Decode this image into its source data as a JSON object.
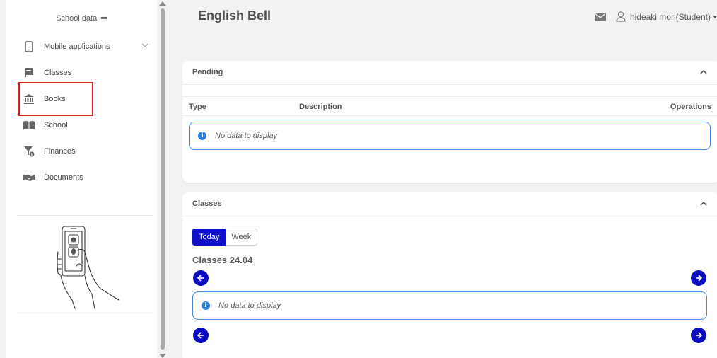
{
  "sidebar": {
    "school_data_label": "School data",
    "school_data_more": "•••",
    "items": [
      {
        "label": "Mobile applications",
        "icon": "mobile-icon",
        "expandable": true
      },
      {
        "label": "Classes",
        "icon": "classes-book-icon"
      },
      {
        "label": "Books",
        "icon": "library-icon",
        "highlighted": true
      },
      {
        "label": "School",
        "icon": "open-book-icon"
      },
      {
        "label": "Finances",
        "icon": "finance-filter-icon"
      },
      {
        "label": "Documents",
        "icon": "handshake-icon"
      }
    ],
    "highlight_color": "#e01818"
  },
  "header": {
    "title": "English Bell",
    "user_name": "hideaki mori(Student)"
  },
  "pending": {
    "title": "Pending",
    "columns": [
      "Type",
      "Description",
      "Operations"
    ],
    "empty_message": "No data to display"
  },
  "classes": {
    "title": "Classes",
    "tabs": [
      {
        "label": "Today",
        "active": true
      },
      {
        "label": "Week",
        "active": false
      }
    ],
    "date_heading": "Classes 24.04",
    "empty_message": "No data to display"
  },
  "colors": {
    "accent": "#1010c8",
    "info_border": "#3f86e6",
    "info_icon": "#2f7fe3"
  }
}
